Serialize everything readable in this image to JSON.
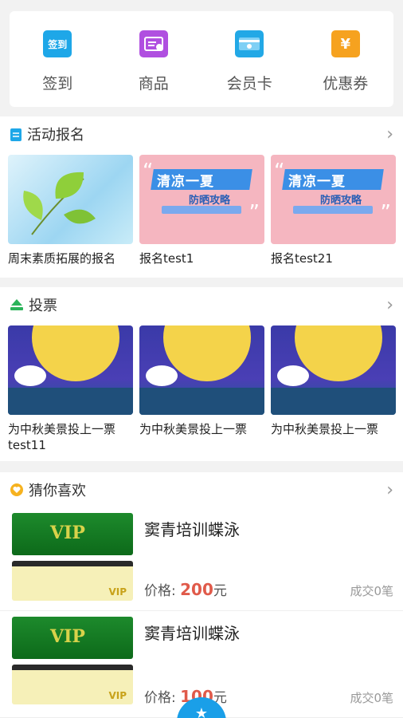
{
  "quick_menu": [
    {
      "label": "签到",
      "icon": "checkin-icon",
      "color": "#1ea7e8",
      "badge": "签到"
    },
    {
      "label": "商品",
      "icon": "goods-icon",
      "color": "#b04fe0"
    },
    {
      "label": "会员卡",
      "icon": "membership-card-icon",
      "color": "#22a8e6"
    },
    {
      "label": "优惠券",
      "icon": "coupon-icon",
      "color": "#f6a21f"
    }
  ],
  "activity": {
    "title": "活动报名",
    "more": "›",
    "items": [
      {
        "title": "周末素质拓展的报名"
      },
      {
        "title": "报名test1",
        "banner_main": "清凉一夏",
        "banner_sub": "防晒攻略"
      },
      {
        "title": "报名test21",
        "banner_main": "清凉一夏",
        "banner_sub": "防晒攻略"
      }
    ]
  },
  "vote": {
    "title": "投票",
    "more": "›",
    "items": [
      {
        "title": "为中秋美景投上一票test11"
      },
      {
        "title": "为中秋美景投上一票"
      },
      {
        "title": "为中秋美景投上一票"
      }
    ]
  },
  "guess": {
    "title": "猜你喜欢",
    "more": "›",
    "price_label": "价格:",
    "items": [
      {
        "title": "窦青培训蝶泳",
        "price": "200",
        "unit": "元",
        "sales": "成交0笔"
      },
      {
        "title": "窦青培训蝶泳",
        "price": "100",
        "unit": "元",
        "sales": "成交0笔"
      }
    ]
  },
  "vip_label": "VIP",
  "fab_icon": "star-icon"
}
